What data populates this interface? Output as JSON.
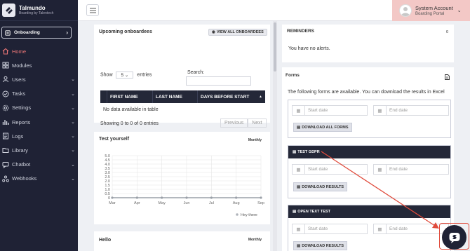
{
  "brand": {
    "name": "Talmundo",
    "sub": "Boarding by Talentech"
  },
  "sidebar": {
    "onboarding_label": "Onboarding",
    "items": [
      {
        "label": "Home",
        "icon": "home-icon",
        "active": true
      },
      {
        "label": "Modules",
        "icon": "modules-icon"
      },
      {
        "label": "Users",
        "icon": "users-icon"
      },
      {
        "label": "Tasks",
        "icon": "tasks-icon"
      },
      {
        "label": "Settings",
        "icon": "settings-icon"
      },
      {
        "label": "Reports",
        "icon": "reports-icon"
      },
      {
        "label": "Logs",
        "icon": "logs-icon"
      },
      {
        "label": "Library",
        "icon": "library-icon"
      },
      {
        "label": "Chatbot",
        "icon": "chatbot-icon"
      },
      {
        "label": "Webhooks",
        "icon": "webhooks-icon"
      }
    ]
  },
  "account": {
    "name": "System Account",
    "sub": "Boarding Portal"
  },
  "upcoming": {
    "title": "Upcoming onboardees",
    "view_all": "VIEW ALL ONBOARDEES",
    "show": "Show",
    "entries_value": "5",
    "entries": "entries",
    "search_label": "Search:",
    "columns": [
      "FIRST NAME",
      "LAST NAME",
      "DAYS BEFORE START"
    ],
    "no_data": "No data available in table",
    "showing": "Showing 0 to 0 of 0 entries",
    "prev": "Previous",
    "next": "Next"
  },
  "test_yourself": {
    "title": "Test yourself",
    "period": "Monthly",
    "legend": "Hey there"
  },
  "hello": {
    "title": "Hello",
    "period": "Monthly"
  },
  "reminders": {
    "title": "REMINDERS",
    "count": "0",
    "message": "You have no alerts."
  },
  "forms": {
    "title": "Forms",
    "description": "The following forms are available. You can download the results in Excel",
    "start_placeholder": "Start date",
    "end_placeholder": "End date",
    "download_all": "DOWNLOAD ALL FORMS",
    "download_results": "DOWNLOAD RESULTS",
    "blocks": [
      {
        "name": "TEST GDPR"
      },
      {
        "name": "OPEN TEXT TEST"
      }
    ]
  },
  "colors": {
    "sidebar": "#1f2235",
    "accent": "#e04b3c",
    "account_bg": "#f3c8c6"
  },
  "chart_data": {
    "type": "line",
    "categories": [
      "Mar",
      "Apr",
      "May",
      "Jun",
      "Jul",
      "Aug",
      "Sep"
    ],
    "series": [
      {
        "name": "Hey there",
        "values": [
          0,
          0,
          0,
          0,
          0,
          0,
          0
        ]
      }
    ],
    "yticks": [
      "0",
      "0.5",
      "1.0",
      "1.5",
      "2.0",
      "2.5",
      "3.0",
      "3.5",
      "4.0",
      "4.5",
      "5.0"
    ],
    "ylim": [
      0,
      5
    ],
    "grid": true,
    "legend": "bottom-right"
  }
}
